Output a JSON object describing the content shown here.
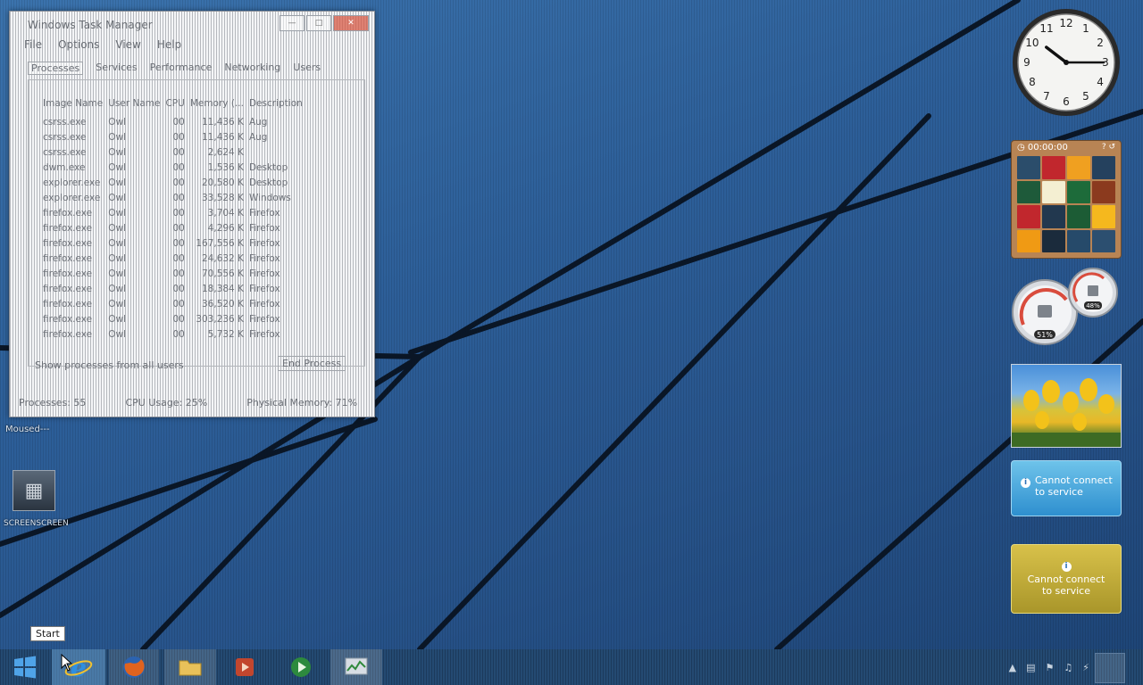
{
  "taskmgr": {
    "title": "Windows Task Manager",
    "menu": [
      "File",
      "Options",
      "View",
      "Help"
    ],
    "tabs": [
      "Processes",
      "Services",
      "Performance",
      "Networking",
      "Users"
    ],
    "columns": [
      "Image Name",
      "User Name",
      "CPU",
      "Memory (...",
      "Description"
    ],
    "rows": [
      [
        "csrss.exe",
        "Owl",
        "00",
        "11,436 K",
        "Aug"
      ],
      [
        "csrss.exe",
        "Owl",
        "00",
        "11,436 K",
        "Aug"
      ],
      [
        "csrss.exe",
        "Owl",
        "00",
        "2,624 K",
        ""
      ],
      [
        "dwm.exe",
        "Owl",
        "00",
        "1,536 K",
        "Desktop"
      ],
      [
        "explorer.exe",
        "Owl",
        "00",
        "20,580 K",
        "Desktop"
      ],
      [
        "explorer.exe",
        "Owl",
        "00",
        "33,528 K",
        "Windows"
      ],
      [
        "firefox.exe",
        "Owl",
        "00",
        "3,704 K",
        "Firefox"
      ],
      [
        "firefox.exe",
        "Owl",
        "00",
        "4,296 K",
        "Firefox"
      ],
      [
        "firefox.exe",
        "Owl",
        "00",
        "167,556 K",
        "Firefox"
      ],
      [
        "firefox.exe",
        "Owl",
        "00",
        "24,632 K",
        "Firefox"
      ],
      [
        "firefox.exe",
        "Owl",
        "00",
        "70,556 K",
        "Firefox"
      ],
      [
        "firefox.exe",
        "Owl",
        "00",
        "18,384 K",
        "Firefox"
      ],
      [
        "firefox.exe",
        "Owl",
        "00",
        "36,520 K",
        "Firefox"
      ],
      [
        "firefox.exe",
        "Owl",
        "00",
        "303,236 K",
        "Firefox"
      ],
      [
        "firefox.exe",
        "Owl",
        "00",
        "5,732 K",
        "Firefox"
      ]
    ],
    "show_all_label": "Show processes from all users",
    "end_process_label": "End Process",
    "status": {
      "processes": "Processes: 55",
      "cpu": "CPU Usage: 25%",
      "memory": "Physical Memory: 71%"
    }
  },
  "desktop": {
    "label_moused": "Moused---",
    "icon_label": "SCREENSCREEN"
  },
  "gadgets": {
    "clock": {
      "hour": 10,
      "minute": 15
    },
    "puzzle": {
      "timer": "00:00:00"
    },
    "meter": {
      "cpu": "51%",
      "memory": "48%"
    },
    "weather": {
      "message": "Cannot connect to service"
    },
    "currency": {
      "message": "Cannot connect to service"
    }
  },
  "tooltip": {
    "text": "Start"
  },
  "colors": {
    "wallpaper": "#2e5d97",
    "taskbar": "#1c3a5c",
    "weather_gadget": "#2e8fcf",
    "currency_gadget": "#a9962a"
  },
  "icons": {
    "start": "windows-logo-icon",
    "ie": "internet-explorer-icon",
    "firefox": "firefox-icon",
    "folder": "folder-icon",
    "media": "media-icon",
    "wmp": "windows-media-player-icon",
    "taskmgr": "task-manager-icon"
  }
}
